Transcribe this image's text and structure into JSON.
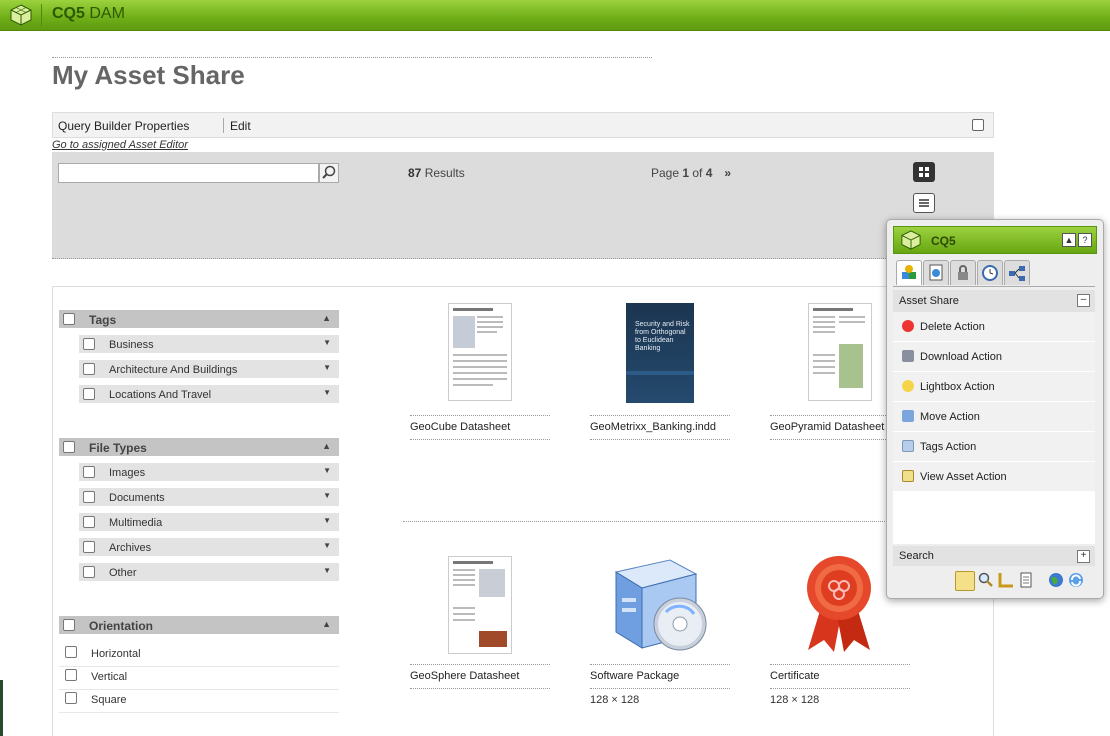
{
  "app": {
    "brand_strong": "CQ5",
    "brand_light": " DAM"
  },
  "page": {
    "title": "My Asset Share"
  },
  "querybar": {
    "builder_label": "Query Builder Properties",
    "edit_label": "Edit",
    "asset_editor_link": "Go to assigned Asset Editor"
  },
  "search": {
    "value": "",
    "placeholder": ""
  },
  "results": {
    "count": "87",
    "label": " Results"
  },
  "pager": {
    "prefix": "Page ",
    "current": "1",
    "of": " of ",
    "total": "4",
    "next": "»"
  },
  "facets": {
    "tags": {
      "title": "Tags",
      "items": [
        "Business",
        "Architecture And Buildings",
        "Locations And Travel"
      ]
    },
    "file_types": {
      "title": "File Types",
      "items": [
        "Images",
        "Documents",
        "Multimedia",
        "Archives",
        "Other"
      ]
    },
    "orientation": {
      "title": "Orientation",
      "items": [
        "Horizontal",
        "Vertical",
        "Square"
      ]
    }
  },
  "assets": [
    {
      "name": "GeoCube Datasheet",
      "dims": ""
    },
    {
      "name": "GeoMetrixx_Banking.indd",
      "dims": "",
      "cover_text": "Security and Risk from Orthogonal to Euclidean Banking"
    },
    {
      "name": "GeoPyramid Datasheet",
      "dims": ""
    },
    {
      "name": "GeoSphere Datasheet",
      "dims": ""
    },
    {
      "name": "Software Package",
      "dims": "128 × 128"
    },
    {
      "name": "Certificate",
      "dims": "128 × 128"
    }
  ],
  "panel": {
    "title": "CQ5",
    "collapse_btn": "▲",
    "help_btn": "?",
    "section_title": "Asset Share",
    "section_toggle": "–",
    "actions": [
      "Delete Action",
      "Download Action",
      "Lightbox Action",
      "Move Action",
      "Tags Action",
      "View Asset Action"
    ],
    "search_label": "Search",
    "search_toggle": "+"
  }
}
